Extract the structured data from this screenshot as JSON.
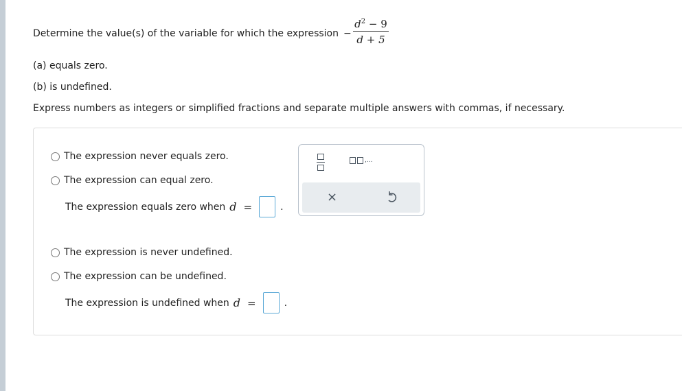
{
  "question": {
    "prompt": "Determine the value(s) of the variable for which the expression",
    "expression": {
      "sign": "−",
      "numerator": "d",
      "numerator_exp": "2",
      "numerator_rest": " − 9",
      "denominator": "d + 5"
    },
    "part_a": "(a) equals zero.",
    "part_b": "(b) is undefined.",
    "instructions": "Express numbers as integers or simplified fractions and separate multiple answers with commas, if necessary."
  },
  "part_a_options": {
    "never": "The expression never equals zero.",
    "can": "The expression can equal zero.",
    "answer_prefix": "The expression equals zero when",
    "variable": "d",
    "equals": "=",
    "period": "."
  },
  "part_b_options": {
    "never": "The expression is never undefined.",
    "can": "The expression can be undefined.",
    "answer_prefix": "The expression is undefined when",
    "variable": "d",
    "equals": "=",
    "period": "."
  },
  "toolbar": {
    "list_suffix": ",...",
    "clear_symbol": "×",
    "icons": [
      "fraction-icon",
      "list-icon",
      "clear-icon",
      "undo-icon"
    ]
  },
  "colors": {
    "left_bar": "#c5ced6",
    "input_border": "#5aa8d6",
    "toolbar_bg": "#e8ecef"
  }
}
